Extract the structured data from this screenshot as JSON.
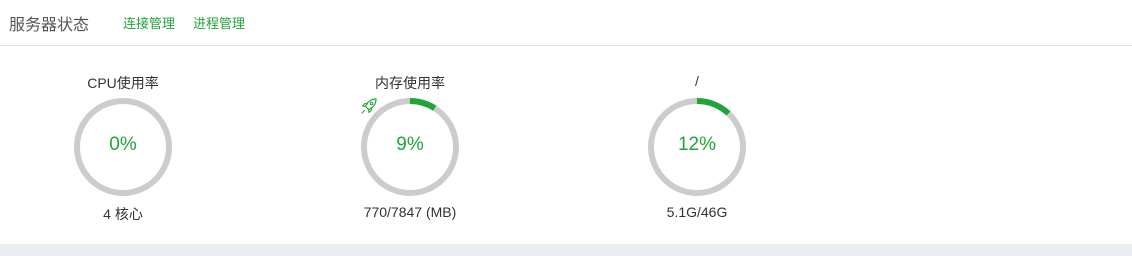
{
  "header": {
    "title": "服务器状态",
    "links": [
      "连接管理",
      "进程管理"
    ]
  },
  "colors": {
    "accent": "#20a53a",
    "track": "#cccccc"
  },
  "gauges": [
    {
      "title": "CPU使用率",
      "value_text": "0%",
      "percent": 0,
      "sub": "4 核心"
    },
    {
      "title": "内存使用率",
      "value_text": "9%",
      "percent": 9,
      "sub": "770/7847 (MB)",
      "icon": "rocket-icon"
    },
    {
      "title": "/",
      "value_text": "12%",
      "percent": 12,
      "sub": "5.1G/46G"
    }
  ]
}
